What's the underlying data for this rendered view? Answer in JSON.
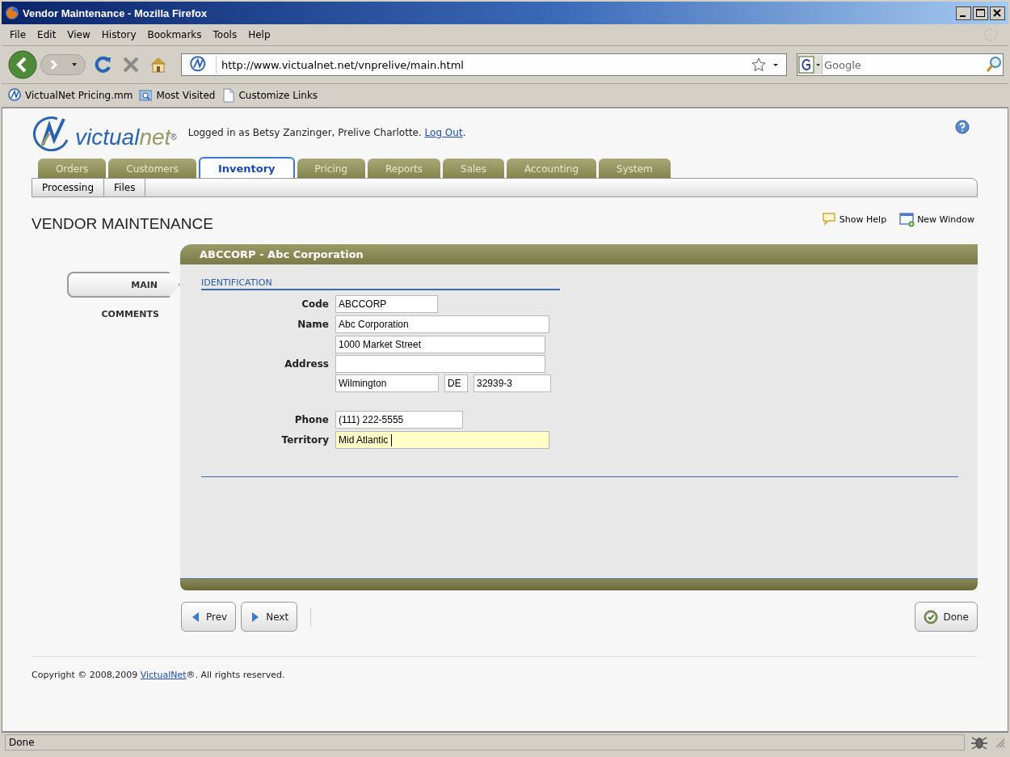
{
  "window": {
    "title": "Vendor Maintenance - Mozilla Firefox"
  },
  "menu": [
    "File",
    "Edit",
    "View",
    "History",
    "Bookmarks",
    "Tools",
    "Help"
  ],
  "address_bar": {
    "url": "http://www.victualnet.net/vnprelive/main.html"
  },
  "search": {
    "placeholder": "Google"
  },
  "bookmarks": [
    {
      "label": "VictualNet Pricing.mm",
      "kind": "site"
    },
    {
      "label": "Most Visited",
      "kind": "folder"
    },
    {
      "label": "Customize Links",
      "kind": "page"
    }
  ],
  "header": {
    "logo": {
      "first": "victual",
      "second": "net",
      "mark": "®"
    },
    "login_text": "Logged in as Betsy Zanzinger, Prelive Charlotte.",
    "logout_link": "Log Out",
    "after_link": "."
  },
  "tabs": [
    {
      "label": "Orders",
      "selected": false
    },
    {
      "label": "Customers",
      "selected": false
    },
    {
      "label": "Inventory",
      "selected": true
    },
    {
      "label": "Pricing",
      "selected": false
    },
    {
      "label": "Reports",
      "selected": false
    },
    {
      "label": "Sales",
      "selected": false
    },
    {
      "label": "Accounting",
      "selected": false
    },
    {
      "label": "System",
      "selected": false
    }
  ],
  "subtabs": [
    "Processing",
    "Files"
  ],
  "page_title": "VENDOR MAINTENANCE",
  "actions": [
    {
      "label": "Show Help",
      "kind": "help"
    },
    {
      "label": "New Window",
      "kind": "window"
    }
  ],
  "record": {
    "title": "ABCCORP - Abc Corporation"
  },
  "side_tabs": [
    {
      "label": "MAIN",
      "selected": true
    },
    {
      "label": "COMMENTS",
      "selected": false
    }
  ],
  "section": {
    "title": "IDENTIFICATION"
  },
  "fields": [
    {
      "kind": "text",
      "label": "Code",
      "value": "ABCCORP",
      "focused": false
    },
    {
      "kind": "text",
      "label": "Name",
      "value": "Abc Corporation",
      "focused": false
    },
    {
      "kind": "address",
      "label": "Address",
      "street": "1000 Market Street",
      "city": "Wilmington",
      "state": "DE",
      "zip": "32939-3"
    },
    {
      "kind": "text",
      "label": "Phone",
      "value": "(111) 222-5555",
      "focused": false
    },
    {
      "kind": "text",
      "label": "Territory",
      "value": "Mid Atlantic",
      "focused": true
    }
  ],
  "nav_buttons": [
    {
      "label": "Prev",
      "kind": "prev"
    },
    {
      "label": "Next",
      "kind": "next"
    }
  ],
  "done_button": {
    "label": "Done"
  },
  "footer": {
    "before": "Copyright © 2008,2009 ",
    "link": "VictualNet",
    "after": "®. All rights reserved."
  },
  "status_bar": {
    "text": "Done"
  }
}
